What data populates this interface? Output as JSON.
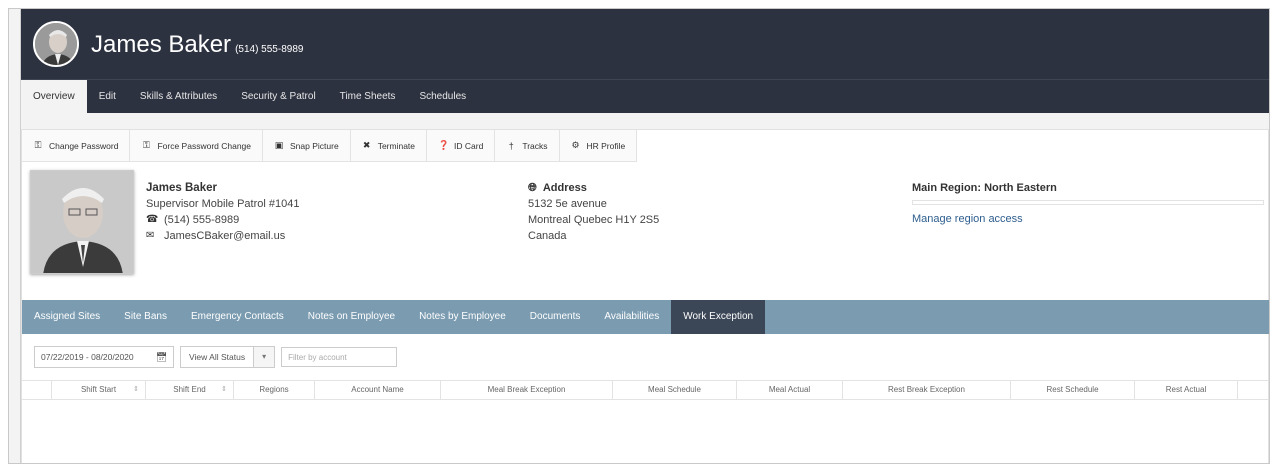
{
  "employee": {
    "name": "James Baker",
    "phone": "(514) 555-8989",
    "title": "Supervisor Mobile Patrol #1041",
    "email": "JamesCBaker@email.us"
  },
  "main_tabs": [
    {
      "label": "Overview",
      "active": true
    },
    {
      "label": "Edit",
      "active": false
    },
    {
      "label": "Skills & Attributes",
      "active": false
    },
    {
      "label": "Security & Patrol",
      "active": false
    },
    {
      "label": "Time Sheets",
      "active": false
    },
    {
      "label": "Schedules",
      "active": false
    }
  ],
  "toolbar": [
    {
      "label": "Change Password",
      "icon": "key-icon"
    },
    {
      "label": "Force Password Change",
      "icon": "key-icon"
    },
    {
      "label": "Snap Picture",
      "icon": "camera-icon"
    },
    {
      "label": "Terminate",
      "icon": "close-icon"
    },
    {
      "label": "ID Card",
      "icon": "question-icon"
    },
    {
      "label": "Tracks",
      "icon": "pin-icon"
    },
    {
      "label": "HR Profile",
      "icon": "gear-icon"
    }
  ],
  "address": {
    "heading": "Address",
    "line1": "5132 5e avenue",
    "line2": "Montreal Quebec H1Y 2S5",
    "line3": "Canada"
  },
  "region": {
    "heading": "Main Region: North Eastern",
    "manage_link": "Manage region access"
  },
  "sub_tabs": [
    {
      "label": "Assigned Sites",
      "active": false
    },
    {
      "label": "Site Bans",
      "active": false
    },
    {
      "label": "Emergency Contacts",
      "active": false
    },
    {
      "label": "Notes on Employee",
      "active": false
    },
    {
      "label": "Notes by Employee",
      "active": false
    },
    {
      "label": "Documents",
      "active": false
    },
    {
      "label": "Availabilities",
      "active": false
    },
    {
      "label": "Work Exception",
      "active": true
    }
  ],
  "filters": {
    "date_range": "07/22/2019 - 08/20/2020",
    "status": "View All Status",
    "account_placeholder": "Filter by account"
  },
  "table": {
    "columns": [
      "",
      "Shift Start",
      "Shift End",
      "Regions",
      "Account Name",
      "Meal Break Exception",
      "Meal Schedule",
      "Meal Actual",
      "Rest Break Exception",
      "Rest Schedule",
      "Rest Actual",
      ""
    ]
  },
  "colors": {
    "header_bg": "#2d3240",
    "subtab_bg": "#7a9bb0",
    "subtab_active": "#3b4656",
    "link": "#2e5e8e"
  }
}
